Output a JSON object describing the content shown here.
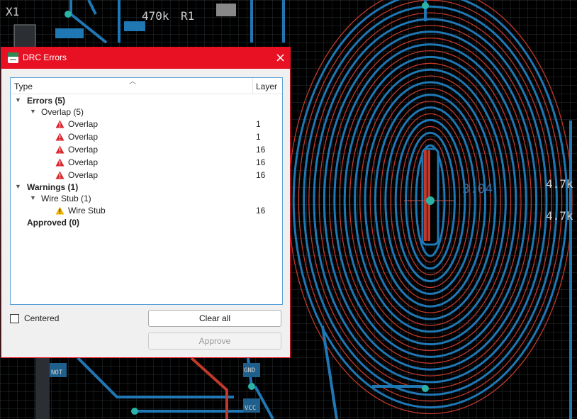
{
  "pcb": {
    "labels": [
      "X1",
      "R1",
      "470k",
      "NOT",
      "GND",
      "VCC",
      "4.7k",
      "4.7k",
      "3.04"
    ],
    "colors": {
      "background": "#000000",
      "grid": "#2a2f35",
      "bottom_copper": "#1f77b4",
      "top_copper": "#c0392b",
      "pad": "#2ab3a6"
    }
  },
  "dialog": {
    "title": "DRC Errors",
    "close_glyph": "×",
    "columns": {
      "type": "Type",
      "layer": "Layer"
    },
    "rows": [
      {
        "label": "Errors (5)",
        "layer": ""
      },
      {
        "label": "Overlap (5)",
        "layer": ""
      },
      {
        "label": "Overlap",
        "layer": "1"
      },
      {
        "label": "Overlap",
        "layer": "1"
      },
      {
        "label": "Overlap",
        "layer": "16"
      },
      {
        "label": "Overlap",
        "layer": "16"
      },
      {
        "label": "Overlap",
        "layer": "16"
      },
      {
        "label": "Warnings (1)",
        "layer": ""
      },
      {
        "label": "Wire Stub (1)",
        "layer": ""
      },
      {
        "label": "Wire Stub",
        "layer": "16"
      },
      {
        "label": "Approved (0)",
        "layer": ""
      }
    ],
    "centered_label": "Centered",
    "centered_checked": false,
    "clear_all_label": "Clear all",
    "approve_label": "Approve",
    "colors": {
      "accent": "#e81123",
      "error": "#d9262c",
      "warning": "#f0b400"
    }
  }
}
